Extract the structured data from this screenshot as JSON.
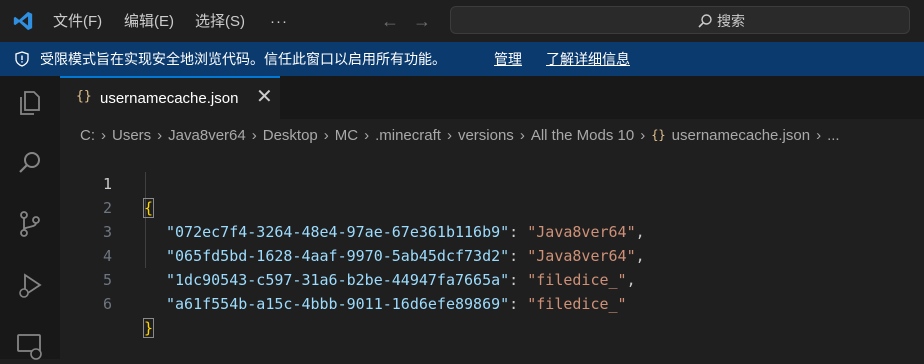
{
  "menu": {
    "file": "文件(F)",
    "edit": "编辑(E)",
    "select": "选择(S)",
    "more": "···"
  },
  "search": {
    "label": "搜索"
  },
  "banner": {
    "message": "受限模式旨在实现安全地浏览代码。信任此窗口以启用所有功能。",
    "manage": "管理",
    "learn_more": "了解详细信息",
    "color": "#0b3a6e"
  },
  "tab": {
    "icon": "{}",
    "title": "usernamecache.json",
    "close": "✕",
    "accent": "#0078d4"
  },
  "breadcrumb": [
    "C:",
    "Users",
    "Java8ver64",
    "Desktop",
    "MC",
    ".minecraft",
    "versions",
    "All the Mods 10",
    "usernamecache.json",
    "..."
  ],
  "breadcrumb_file_icon": "{}",
  "editor": {
    "lines": [
      {
        "num": "1",
        "open": "{"
      },
      {
        "num": "2",
        "key": "\"072ec7f4-3264-48e4-97ae-67e361b116b9\"",
        "value": "\"Java8ver64\"",
        "comma": ","
      },
      {
        "num": "3",
        "key": "\"065fd5bd-1628-4aaf-9970-5ab45dcf73d2\"",
        "value": "\"Java8ver64\"",
        "comma": ","
      },
      {
        "num": "4",
        "key": "\"1dc90543-c597-31a6-b2be-44947fa7665a\"",
        "value": "\"filedice_\"",
        "comma": ","
      },
      {
        "num": "5",
        "key": "\"a61f554b-a15c-4bbb-9011-16d6efe89869\"",
        "value": "\"filedice_\"",
        "comma": ""
      },
      {
        "num": "6",
        "close": "}"
      }
    ],
    "colon": ": "
  },
  "icons": {
    "logo": "vscode-logo-icon",
    "back": "arrow-left-icon",
    "forward": "arrow-right-icon",
    "search": "search-icon",
    "shield": "shield-icon",
    "explorer": "files-icon",
    "search_view": "search-icon",
    "scm": "source-control-icon",
    "debug": "run-debug-icon",
    "remote": "remote-explorer-icon"
  }
}
